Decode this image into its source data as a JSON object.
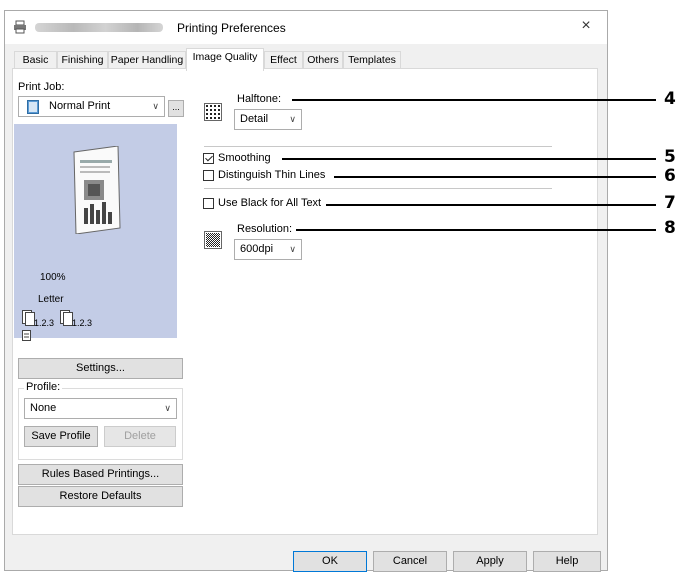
{
  "window": {
    "title": "Printing Preferences",
    "close_glyph": "×"
  },
  "tabs": [
    {
      "label": "Basic"
    },
    {
      "label": "Finishing"
    },
    {
      "label": "Paper Handling"
    },
    {
      "label": "Image Quality",
      "active": true
    },
    {
      "label": "Effect"
    },
    {
      "label": "Others"
    },
    {
      "label": "Templates"
    }
  ],
  "left_panel": {
    "print_job_label": "Print Job:",
    "print_job_value": "Normal Print",
    "browse_label": "...",
    "zoom": "100%",
    "paper": "Letter",
    "order_left": "1.2.3",
    "order_right": "1.2.3",
    "settings_button": "Settings...",
    "profile_label": "Profile:",
    "profile_value": "None",
    "save_profile_button": "Save Profile",
    "delete_button": "Delete",
    "rules_button": "Rules Based Printings...",
    "restore_button": "Restore Defaults"
  },
  "image_quality": {
    "halftone_label": "Halftone:",
    "halftone_value": "Detail",
    "smoothing_label": "Smoothing",
    "smoothing_checked": true,
    "thin_lines_label": "Distinguish Thin Lines",
    "thin_lines_checked": false,
    "black_text_label": "Use Black for All Text",
    "black_text_checked": false,
    "resolution_label": "Resolution:",
    "resolution_value": "600dpi"
  },
  "callouts": [
    "4",
    "5",
    "6",
    "7",
    "8"
  ],
  "footer": {
    "ok": "OK",
    "cancel": "Cancel",
    "apply": "Apply",
    "help": "Help"
  },
  "icons": [
    "printer-icon",
    "halftone-icon",
    "resolution-icon",
    "document-preview-icon",
    "chevron-down-icon",
    "close-icon"
  ]
}
